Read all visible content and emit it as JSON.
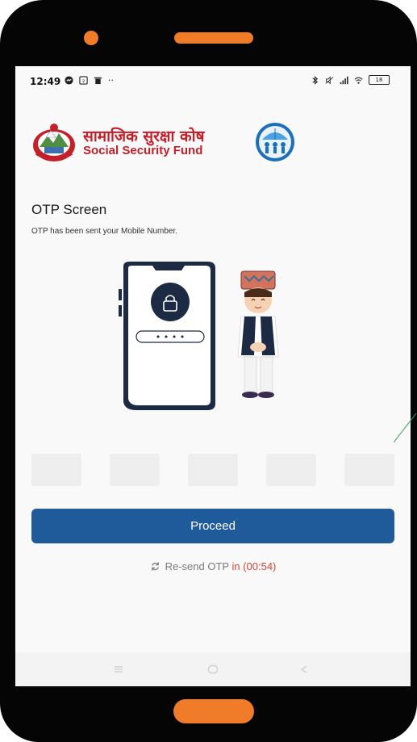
{
  "status_bar": {
    "time": "12:49",
    "extra": "··",
    "battery": "18"
  },
  "header": {
    "logo_nepali": "सामाजिक सुरक्षा कोष",
    "logo_english": "Social Security Fund"
  },
  "main": {
    "title": "OTP Screen",
    "subtitle": "OTP has been sent your Mobile Number.",
    "illustration_mask": "• • • •"
  },
  "otp": {
    "fields": [
      "",
      "",
      "",
      "",
      ""
    ]
  },
  "actions": {
    "proceed_label": "Proceed",
    "resend_label": "Re-send OTP",
    "resend_timer": "in (00:54)"
  },
  "colors": {
    "frame": "#050505",
    "accent_orange": "#f07c2a",
    "primary_button": "#1f5a9a",
    "timer_red": "#d34836",
    "logo_red": "#c4202a"
  },
  "icons": [
    "messenger-icon",
    "notification-icon",
    "trash-icon",
    "bluetooth-icon",
    "mute-icon",
    "signal-icon",
    "wifi-icon",
    "battery-icon",
    "lock-icon",
    "refresh-icon",
    "recents-icon",
    "home-icon",
    "back-icon"
  ]
}
